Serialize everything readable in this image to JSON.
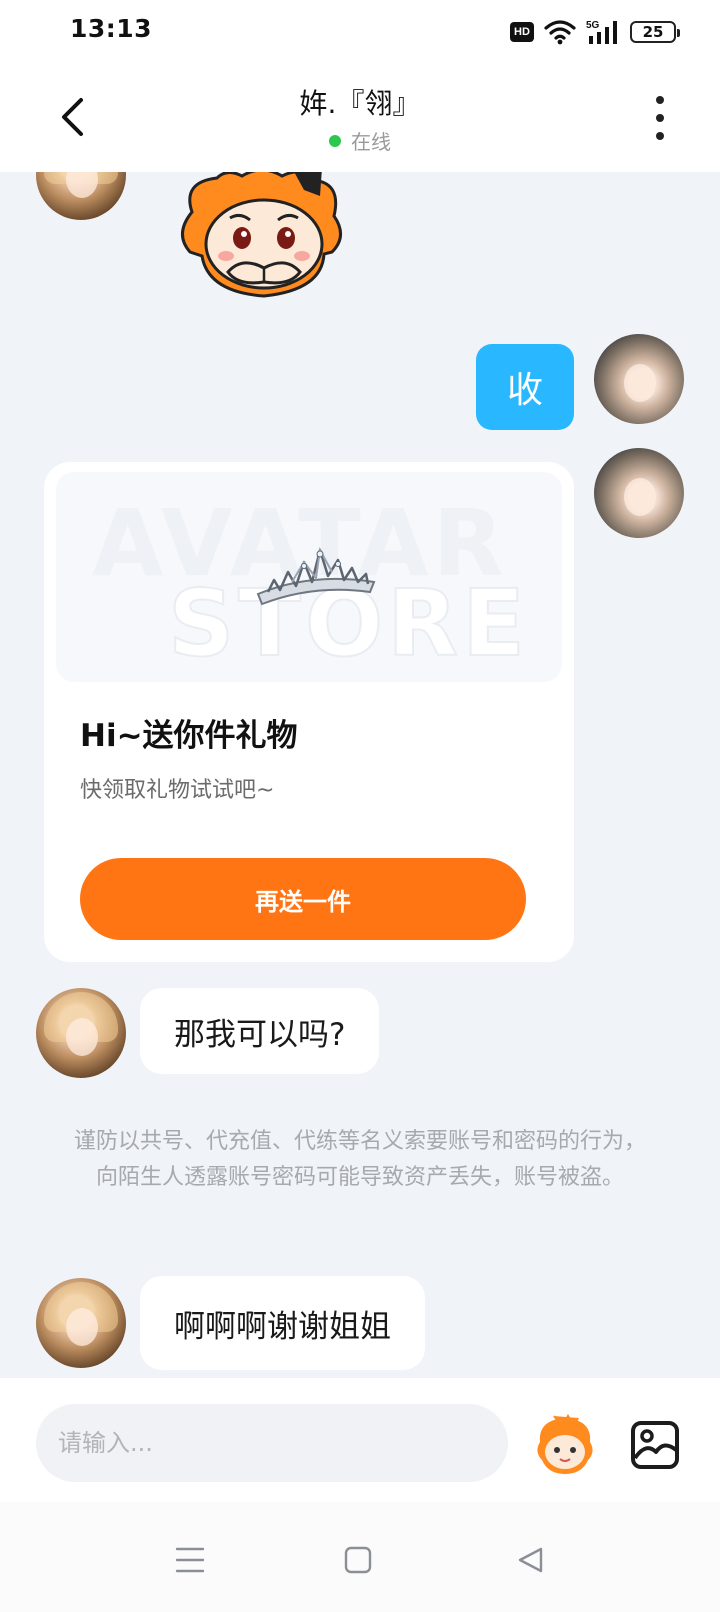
{
  "status_bar": {
    "time": "13:13",
    "hd": "HD",
    "network": "5G",
    "battery": "25"
  },
  "header": {
    "title": "姩.『翎』",
    "status": "在线",
    "status_color": "#2dc74f"
  },
  "messages": {
    "sent_text": "收",
    "gift_card": {
      "watermark_top": "AVATAR",
      "watermark_bottom": "STORE",
      "title": "Hi~送你件礼物",
      "subtitle": "快领取礼物试试吧~",
      "button_label": "再送一件",
      "button_color": "#ff7514"
    },
    "received_1": "那我可以吗?",
    "warning": "谨防以共号、代充值、代练等名义索要账号和密码的行为，向陌生人透露账号密码可能导致资产丢失，账号被盗。",
    "received_2": "啊啊啊谢谢姐姐"
  },
  "input": {
    "placeholder": "请输入..."
  },
  "icons": {
    "back": "chevron-left-icon",
    "more": "more-vertical-icon",
    "emoji": "sticker-emoji-icon",
    "image": "image-icon",
    "nav_menu": "menu-icon",
    "nav_home": "home-square-icon",
    "nav_back": "back-triangle-icon"
  },
  "colors": {
    "sent_bubble": "#29b8ff",
    "background": "#f0f3f8"
  }
}
